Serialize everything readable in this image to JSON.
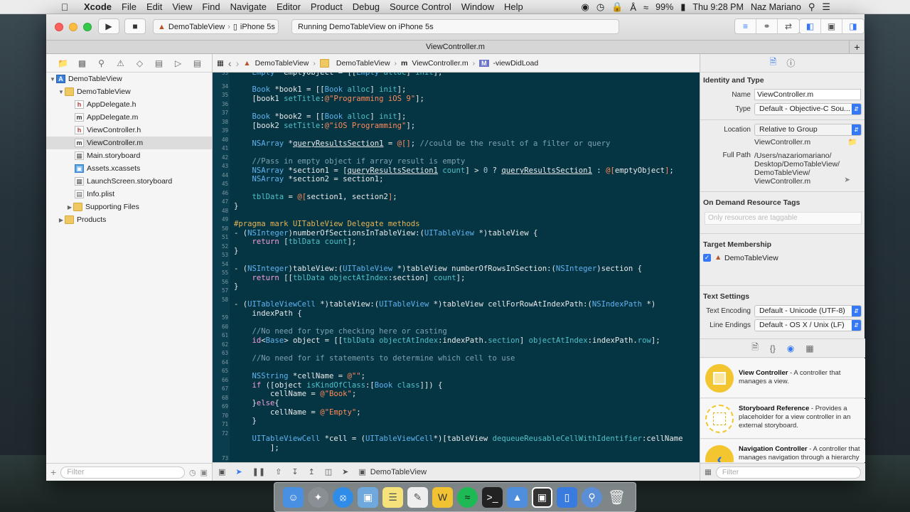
{
  "menubar": {
    "app": "Xcode",
    "items": [
      "File",
      "Edit",
      "View",
      "Find",
      "Navigate",
      "Editor",
      "Product",
      "Debug",
      "Source Control",
      "Window",
      "Help"
    ],
    "battery": "99%",
    "clock": "Thu 9:28 PM",
    "user": "Naz Mariano"
  },
  "toolbar": {
    "scheme_target": "DemoTableView",
    "scheme_device": "iPhone 5s",
    "status": "Running DemoTableView on iPhone 5s"
  },
  "tab_title": "ViewController.m",
  "navigator": {
    "items": [
      {
        "label": "DemoTableView",
        "icon": "project-icon"
      },
      {
        "label": "DemoTableView",
        "icon": "folder-icon"
      },
      {
        "label": "AppDelegate.h",
        "icon": "header-file-icon"
      },
      {
        "label": "AppDelegate.m",
        "icon": "m-file-icon"
      },
      {
        "label": "ViewController.h",
        "icon": "header-file-icon"
      },
      {
        "label": "ViewController.m",
        "icon": "m-file-icon"
      },
      {
        "label": "Main.storyboard",
        "icon": "storyboard-icon"
      },
      {
        "label": "Assets.xcassets",
        "icon": "assets-icon"
      },
      {
        "label": "LaunchScreen.storyboard",
        "icon": "storyboard-icon"
      },
      {
        "label": "Info.plist",
        "icon": "plist-icon"
      },
      {
        "label": "Supporting Files",
        "icon": "folder-icon"
      },
      {
        "label": "Products",
        "icon": "folder-icon"
      }
    ],
    "filter_placeholder": "Filter"
  },
  "jumpbar": {
    "crumbs": [
      "DemoTableView",
      "DemoTableView",
      "ViewController.m",
      "-viewDidLoad"
    ]
  },
  "debug_bar": {
    "target": "DemoTableView"
  },
  "inspector": {
    "identity_title": "Identity and Type",
    "name_label": "Name",
    "name_value": "ViewController.m",
    "type_label": "Type",
    "type_value": "Default - Objective-C Sou...",
    "location_label": "Location",
    "location_value": "Relative to Group",
    "location_file": "ViewController.m",
    "fullpath_label": "Full Path",
    "fullpath_lines": [
      "/Users/nazariomariano/",
      "Desktop/DemoTableView/",
      "DemoTableView/",
      "ViewController.m"
    ],
    "odr_title": "On Demand Resource Tags",
    "odr_placeholder": "Only resources are taggable",
    "target_title": "Target Membership",
    "target_name": "DemoTableView",
    "text_title": "Text Settings",
    "encoding_label": "Text Encoding",
    "encoding_value": "Default - Unicode (UTF-8)",
    "lineend_label": "Line Endings",
    "lineend_value": "Default - OS X / Unix (LF)",
    "library": [
      {
        "title": "View Controller",
        "desc": " - A controller that manages a view."
      },
      {
        "title": "Storyboard Reference",
        "desc": " - Provides a placeholder for a view controller in an external storyboard."
      },
      {
        "title": "Navigation Controller",
        "desc": " - A controller that manages navigation through a hierarchy of views."
      }
    ],
    "filter_placeholder": "Filter"
  },
  "code": {
    "line_numbers": [
      "33",
      "34",
      "35",
      "36",
      "37",
      "38",
      "39",
      "40",
      "41",
      "42",
      "43",
      "44",
      "45",
      "46",
      "47",
      "48",
      "49",
      "50",
      "51",
      "52",
      "53",
      "54",
      "55",
      "56",
      "57",
      "58",
      "",
      "59",
      "60",
      "61",
      "62",
      "63",
      "64",
      "65",
      "66",
      "67",
      "68",
      "69",
      "70",
      "71",
      "72",
      "",
      "73"
    ]
  },
  "colors": {
    "editor_bg": "#053443",
    "accent": "#3478f6",
    "library_icon": "#f3c52e"
  }
}
